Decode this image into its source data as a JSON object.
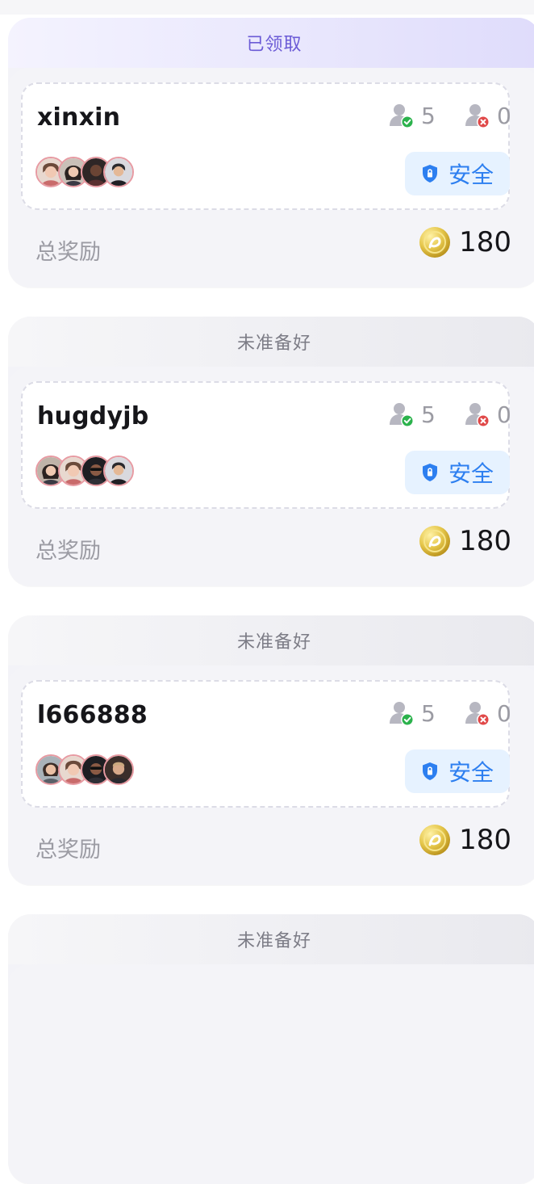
{
  "cards": [
    {
      "status": "已领取",
      "team_name": "xinxin",
      "joined_count": "5",
      "declined_count": "0",
      "badge_label": "安全",
      "reward_label": "总奖励",
      "reward_value": "180"
    },
    {
      "status": "未准备好",
      "team_name": "hugdyjb",
      "joined_count": "5",
      "declined_count": "0",
      "badge_label": "安全",
      "reward_label": "总奖励",
      "reward_value": "180"
    },
    {
      "status": "未准备好",
      "team_name": "l666888",
      "joined_count": "5",
      "declined_count": "0",
      "badge_label": "安全",
      "reward_label": "总奖励",
      "reward_value": "180"
    },
    {
      "status": "未准备好"
    }
  ],
  "colors": {
    "claimed_text": "#6b5bd6",
    "notready_text": "#7c7c86",
    "safe_badge_bg": "#e6f2ff",
    "safe_badge_text": "#2d7ff0",
    "ok_green": "#2bb24c",
    "bad_red": "#e04848",
    "coin_gold": "#e5c64a"
  },
  "icons": {
    "joined": "user-check-icon",
    "declined": "user-x-icon",
    "safe": "shield-lock-icon",
    "coin": "coin-icon"
  }
}
